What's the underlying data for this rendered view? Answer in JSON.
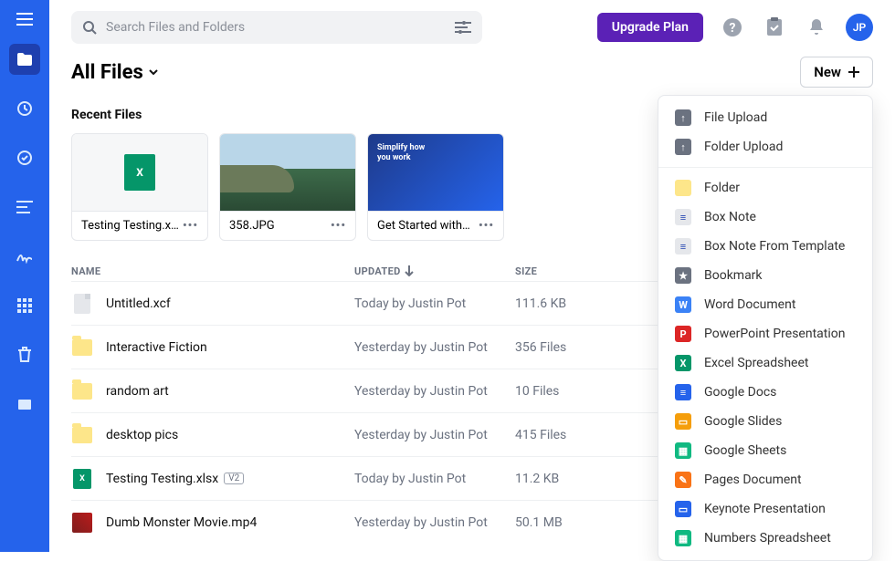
{
  "search": {
    "placeholder": "Search Files and Folders"
  },
  "upgrade_label": "Upgrade Plan",
  "avatar_initials": "JP",
  "page_title": "All Files",
  "new_button_label": "New",
  "recent_label": "Recent Files",
  "recent": [
    {
      "name": "Testing Testing.x…",
      "thumb": "xlsx"
    },
    {
      "name": "358.JPG",
      "thumb": "img1"
    },
    {
      "name": "Get Started with…",
      "thumb": "img2",
      "thumb_text": "Simplify how\nyou work"
    }
  ],
  "columns": {
    "name": "NAME",
    "updated": "UPDATED",
    "size": "SIZE"
  },
  "files": [
    {
      "icon": "file",
      "name": "Untitled.xcf",
      "badge": "",
      "updated": "Today by Justin Pot",
      "size": "111.6 KB"
    },
    {
      "icon": "folder",
      "name": "Interactive Fiction",
      "badge": "",
      "updated": "Yesterday by Justin Pot",
      "size": "356 Files"
    },
    {
      "icon": "folder",
      "name": "random art",
      "badge": "",
      "updated": "Yesterday by Justin Pot",
      "size": "10 Files"
    },
    {
      "icon": "folder",
      "name": "desktop pics",
      "badge": "",
      "updated": "Yesterday by Justin Pot",
      "size": "415 Files"
    },
    {
      "icon": "xlsx",
      "name": "Testing Testing.xlsx",
      "badge": "V2",
      "updated": "Today by Justin Pot",
      "size": "11.2 KB"
    },
    {
      "icon": "mp4",
      "name": "Dumb Monster Movie.mp4",
      "badge": "",
      "updated": "Yesterday by Justin Pot",
      "size": "50.1 MB"
    }
  ],
  "menu": {
    "group1": [
      {
        "icon": "upload-file",
        "label": "File Upload"
      },
      {
        "icon": "upload-folder",
        "label": "Folder Upload"
      }
    ],
    "group2": [
      {
        "icon": "folder",
        "label": "Folder"
      },
      {
        "icon": "note",
        "label": "Box Note"
      },
      {
        "icon": "note",
        "label": "Box Note From Template"
      },
      {
        "icon": "bookmark",
        "label": "Bookmark"
      },
      {
        "icon": "word",
        "label": "Word Document"
      },
      {
        "icon": "ppt",
        "label": "PowerPoint Presentation"
      },
      {
        "icon": "xls",
        "label": "Excel Spreadsheet"
      },
      {
        "icon": "gdoc",
        "label": "Google Docs"
      },
      {
        "icon": "gslide",
        "label": "Google Slides"
      },
      {
        "icon": "gsheet",
        "label": "Google Sheets"
      },
      {
        "icon": "pages",
        "label": "Pages Document"
      },
      {
        "icon": "keynote",
        "label": "Keynote Presentation"
      },
      {
        "icon": "numbers",
        "label": "Numbers Spreadsheet"
      }
    ]
  }
}
